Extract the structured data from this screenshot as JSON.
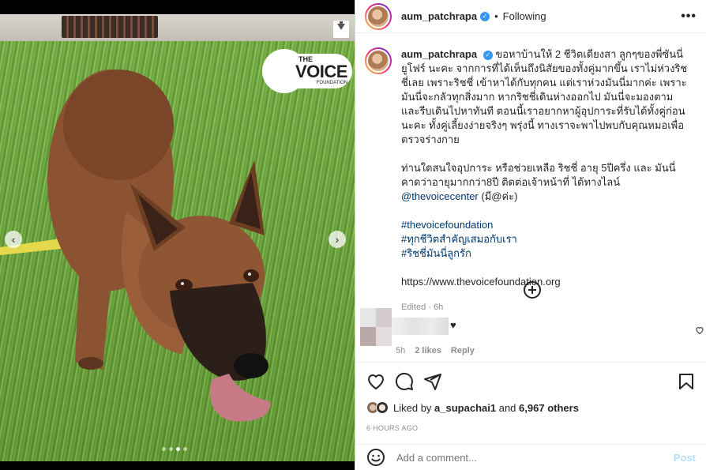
{
  "media": {
    "logo": {
      "line1": "THE",
      "line2": "VOICE",
      "line3": "FOUNDATION"
    },
    "carousel": {
      "slides": 4,
      "active_index": 2
    }
  },
  "header": {
    "username": "aum_patchrapa",
    "separator": "•",
    "following_label": "Following",
    "more_label": "•••"
  },
  "caption": {
    "username": "aum_patchrapa",
    "paragraph1": "ขอหาบ้านให้ 2 ชีวิตเดียงสา ลูกๆของพี่ซันนี่ ยูโฟร์ นะคะ จากการที่ได้เห็นถึงนิสัยของทั้งคู่มากขึ้น เราไม่ห่วงริชชี่เลย เพราะริชชี่ เข้าหาได้กับทุกคน แต่เราห่วงมันนี่มากค่ะ เพราะมันนี่จะกลัวทุกสิ่งมาก หากริชชี่เดินห่างออกไป มันนี่จะมองตามและรีบเดินไปหาทันที ตอนนี้เราอยากหาผู้อุปการะที่รับได้ทั้งคู่ก่อนนะคะ ทั้งคู่เลี้ยงง่ายจริงๆ พรุ่งนี้ ทางเราจะพาไปพบกับคุณหมอเพื่อตรวจร่างกาย",
    "paragraph2": "ท่านใดสนใจอุปการะ หรือช่วยเหลือ ริชชี่ อายุ 5ปีครึ่ง และ มันนี่ คาดว่าอายุมากกว่า8ปี ติดต่อเจ้าหน้าที่ ได้ทางไลน์",
    "mention": "@thevoicecenter",
    "paragraph2_end": "(มี@ค่ะ)",
    "hashtags": [
      "#thevoicefoundation",
      "#ทุกชีวิตสำคัญเสมอกับเรา",
      "#ริชชี่มันนี่ลูกรัก"
    ],
    "url": "https://www.thevoicefoundation.org",
    "edited": "Edited · 6h"
  },
  "comment": {
    "time": "5h",
    "likes": "2 likes",
    "reply": "Reply"
  },
  "actions": {
    "icons": [
      "heart-icon",
      "comment-icon",
      "share-icon",
      "bookmark-icon"
    ]
  },
  "likes": {
    "prefix": "Liked by",
    "user": "a_supachai1",
    "middle": "and",
    "count": "6,967 others"
  },
  "timestamp": "6 HOURS AGO",
  "add_comment": {
    "placeholder": "Add a comment...",
    "post_label": "Post"
  },
  "colors": {
    "link": "#00376b",
    "verified": "#3897f0",
    "post_disabled": "#b2dffc",
    "muted": "#8e8e8e"
  }
}
